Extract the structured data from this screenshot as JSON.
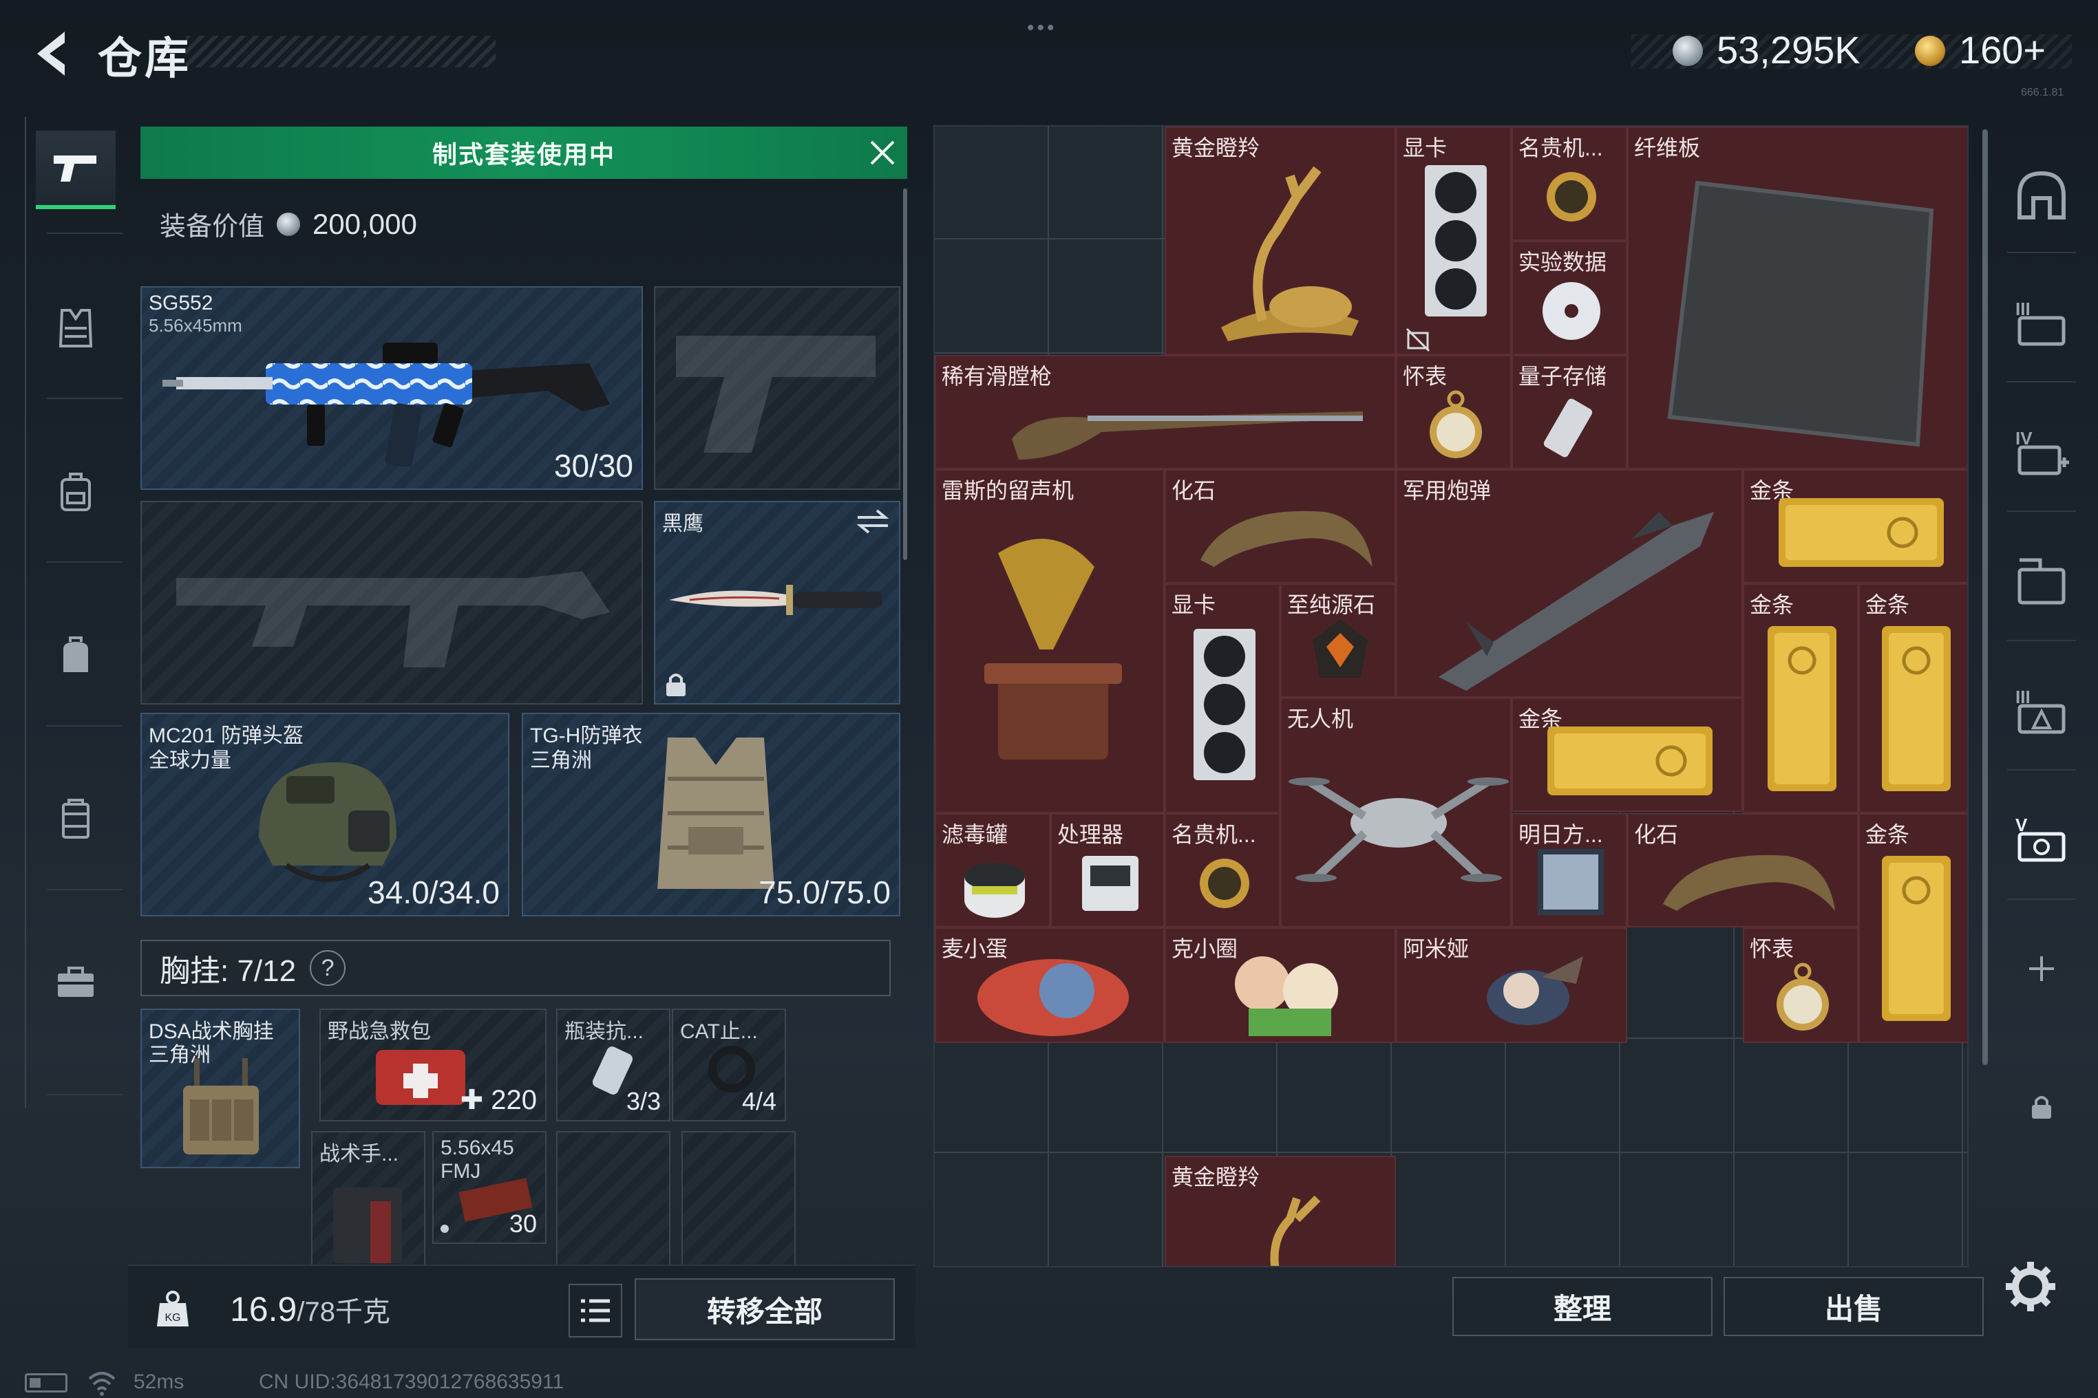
{
  "header": {
    "title": "仓库",
    "drag_indicator": "•••",
    "money": "53,295K",
    "gold": "160+",
    "version_tag": "666.1.81"
  },
  "left_nav": {
    "items": [
      {
        "icon": "pistol-icon",
        "active": true
      },
      {
        "icon": "armor-vest-icon",
        "active": false
      },
      {
        "icon": "backpack-icon",
        "active": false
      },
      {
        "icon": "bag-icon",
        "active": false
      },
      {
        "icon": "case-icon",
        "active": false
      },
      {
        "icon": "briefcase-icon",
        "active": false
      }
    ]
  },
  "loadout": {
    "banner_text": "制式套装使用中",
    "value_label": "装备价值",
    "value_amount": "200,000",
    "primary_weapon": {
      "name": "SG552",
      "caliber": "5.56x45mm",
      "ammo": "30/30"
    },
    "melee": {
      "name": "黑鹰"
    },
    "helmet": {
      "name": "MC201 防弹头盔",
      "source": "全球力量",
      "durability": "34.0/34.0"
    },
    "armor": {
      "name": "TG-H防弹衣",
      "source": "三角洲",
      "durability": "75.0/75.0"
    },
    "rig_label": "胸挂: 7/12",
    "rig_help": "?",
    "rig": {
      "name": "DSA战术胸挂",
      "source": "三角洲"
    },
    "rig_items": [
      {
        "name": "野战急救包",
        "count": "220"
      },
      {
        "name": "瓶装抗...",
        "count": "3/3"
      },
      {
        "name": "CAT止...",
        "count": "4/4"
      },
      {
        "name": "战术手...",
        "count": ""
      },
      {
        "name": "5.56x45 FMJ",
        "count": "30"
      }
    ],
    "weight": "16.9",
    "weight_max": "/78千克",
    "transfer_all": "转移全部"
  },
  "stash": {
    "items": [
      {
        "label": "黄金瞪羚",
        "icon": "golden-gazelle-icon"
      },
      {
        "label": "显卡",
        "icon": "gpu-icon"
      },
      {
        "label": "名贵机...",
        "icon": "gold-watch-icon"
      },
      {
        "label": "纤维板",
        "icon": "fiber-board-icon"
      },
      {
        "label": "实验数据",
        "icon": "disc-icon"
      },
      {
        "label": "稀有滑膛枪",
        "icon": "musket-icon"
      },
      {
        "label": "怀表",
        "icon": "pocket-watch-icon"
      },
      {
        "label": "量子存储",
        "icon": "usb-drive-icon"
      },
      {
        "label": "雷斯的留声机",
        "icon": "gramophone-icon"
      },
      {
        "label": "化石",
        "icon": "fossil-claw-icon"
      },
      {
        "label": "军用炮弹",
        "icon": "missile-icon"
      },
      {
        "label": "金条",
        "icon": "gold-bar-icon"
      },
      {
        "label": "显卡",
        "icon": "gpu-icon"
      },
      {
        "label": "至纯源石",
        "icon": "source-stone-icon"
      },
      {
        "label": "金条",
        "icon": "gold-bar-icon"
      },
      {
        "label": "金条",
        "icon": "gold-bar-icon"
      },
      {
        "label": "无人机",
        "icon": "drone-icon"
      },
      {
        "label": "金条",
        "icon": "gold-bar-icon"
      },
      {
        "label": "滤毒罐",
        "icon": "filter-canister-icon"
      },
      {
        "label": "处理器",
        "icon": "processor-icon"
      },
      {
        "label": "名贵机...",
        "icon": "gold-watch-icon"
      },
      {
        "label": "明日方...",
        "icon": "album-icon"
      },
      {
        "label": "化石",
        "icon": "fossil-claw-icon"
      },
      {
        "label": "金条",
        "icon": "gold-bar-icon"
      },
      {
        "label": "麦小蛋",
        "icon": "egg-figure-icon"
      },
      {
        "label": "克小圈",
        "icon": "figure-icon"
      },
      {
        "label": "阿米娅",
        "icon": "rabbit-figure-icon"
      },
      {
        "label": "怀表",
        "icon": "pocket-watch-icon"
      },
      {
        "label": "黄金瞪羚",
        "icon": "golden-gazelle-icon"
      }
    ],
    "sort_label": "整理",
    "sell_label": "出售"
  },
  "right_nav": {
    "items": [
      {
        "icon": "stash-home-icon"
      },
      {
        "icon": "stash-iii-icon",
        "tag": "III"
      },
      {
        "icon": "stash-iv-icon",
        "tag": "IV"
      },
      {
        "icon": "stash-folder-icon"
      },
      {
        "icon": "stash-iii-b-icon",
        "tag": "III"
      },
      {
        "icon": "stash-active-icon"
      },
      {
        "icon": "add-icon"
      },
      {
        "icon": "lock-icon"
      }
    ]
  },
  "status": {
    "ping": "52ms",
    "uid": "CN UID:36481739012768635911"
  },
  "colors": {
    "accent_green": "#139058",
    "stash_item_bg": "#4a2226",
    "gold": "#c6932e"
  }
}
